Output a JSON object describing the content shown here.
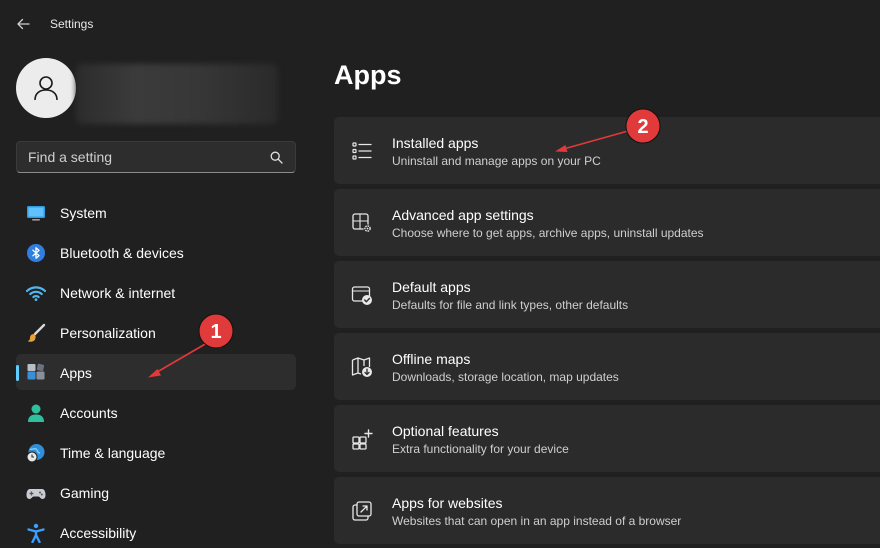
{
  "window": {
    "title": "Settings",
    "back_icon": "back-arrow-icon"
  },
  "profile": {
    "avatar_icon": "person-icon"
  },
  "search": {
    "placeholder": "Find a setting",
    "icon": "search-icon"
  },
  "sidebar": {
    "items": [
      {
        "label": "System",
        "icon": "system-monitor-icon"
      },
      {
        "label": "Bluetooth & devices",
        "icon": "bluetooth-icon"
      },
      {
        "label": "Network & internet",
        "icon": "wifi-icon"
      },
      {
        "label": "Personalization",
        "icon": "paintbrush-icon"
      },
      {
        "label": "Apps",
        "icon": "apps-icon",
        "selected": true
      },
      {
        "label": "Accounts",
        "icon": "account-icon"
      },
      {
        "label": "Time & language",
        "icon": "globe-clock-icon"
      },
      {
        "label": "Gaming",
        "icon": "gamepad-icon"
      },
      {
        "label": "Accessibility",
        "icon": "accessibility-icon"
      }
    ]
  },
  "main": {
    "title": "Apps",
    "cards": [
      {
        "title": "Installed apps",
        "description": "Uninstall and manage apps on your PC",
        "icon": "list-icon"
      },
      {
        "title": "Advanced app settings",
        "description": "Choose where to get apps, archive apps, uninstall updates",
        "icon": "app-settings-icon"
      },
      {
        "title": "Default apps",
        "description": "Defaults for file and link types, other defaults",
        "icon": "default-apps-icon"
      },
      {
        "title": "Offline maps",
        "description": "Downloads, storage location, map updates",
        "icon": "map-download-icon"
      },
      {
        "title": "Optional features",
        "description": "Extra functionality for your device",
        "icon": "add-features-icon"
      },
      {
        "title": "Apps for websites",
        "description": "Websites that can open in an app instead of a browser",
        "icon": "open-link-icon"
      }
    ]
  },
  "annotations": {
    "badge_1": "1",
    "badge_2": "2"
  },
  "colors": {
    "background": "#202020",
    "card": "#2b2b2b",
    "accent": "#60cdff",
    "annotation": "#e03a3a"
  }
}
